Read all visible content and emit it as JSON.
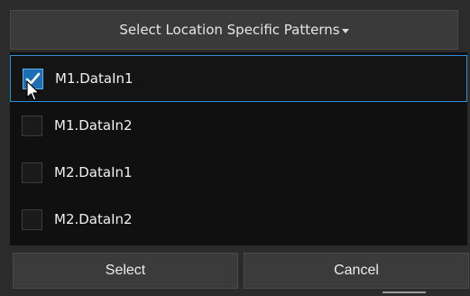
{
  "dialog": {
    "title": "Select Location Specific Patterns",
    "title_icon": "chevron-down-icon"
  },
  "patterns": [
    {
      "label": "M1.DataIn1",
      "checked": true
    },
    {
      "label": "M1.DataIn2",
      "checked": false
    },
    {
      "label": "M2.DataIn1",
      "checked": false
    },
    {
      "label": "M2.DataIn2",
      "checked": false
    }
  ],
  "footer": {
    "select_label": "Select",
    "cancel_label": "Cancel"
  },
  "colors": {
    "accent": "#2f8fd6",
    "background": "#101010",
    "panel": "#2b2b2b"
  }
}
